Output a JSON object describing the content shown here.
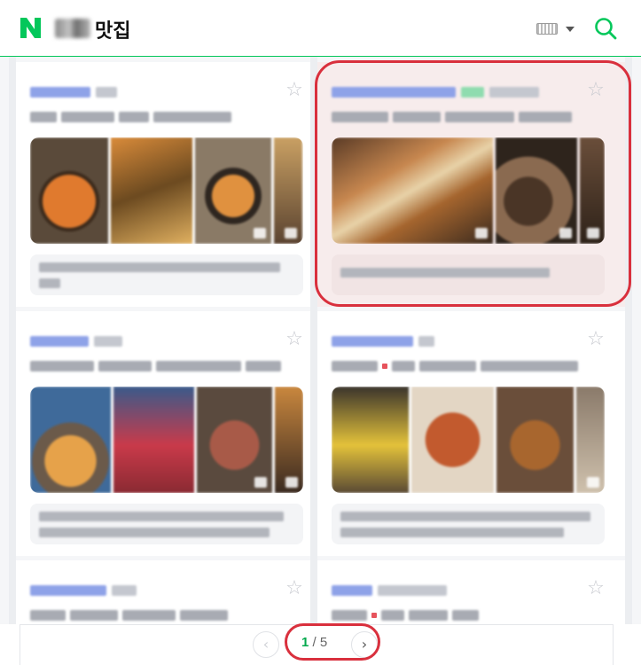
{
  "header": {
    "logo_letter": "N",
    "query_suffix": "맛집",
    "brand_color": "#03c75a",
    "icons": [
      "keyboard-icon",
      "dropdown-caret-icon",
      "search-icon"
    ]
  },
  "cards": [
    {
      "position": "left",
      "rating_stars": 0
    },
    {
      "position": "right",
      "highlighted": true
    },
    {
      "position": "left"
    },
    {
      "position": "right"
    },
    {
      "position": "left"
    },
    {
      "position": "right"
    }
  ],
  "pager": {
    "current": "1",
    "separator": "/",
    "total": "5",
    "prev_icon": "chevron-left-icon",
    "next_icon": "chevron-right-icon",
    "prev_glyph": "‹",
    "next_glyph": "›"
  },
  "annotation_color": "#d9303d"
}
